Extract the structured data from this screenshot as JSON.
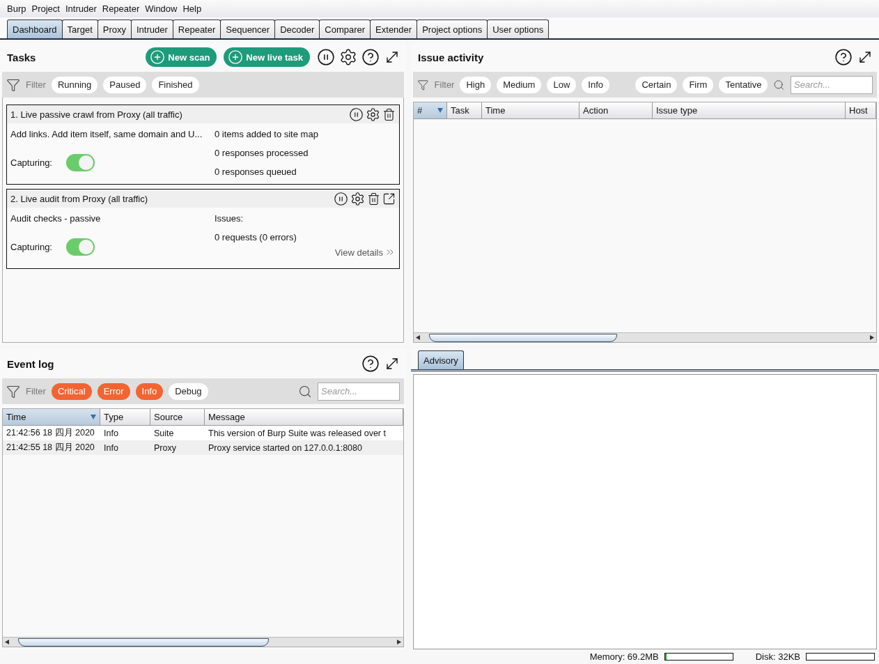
{
  "menu": [
    "Burp",
    "Project",
    "Intruder",
    "Repeater",
    "Window",
    "Help"
  ],
  "tabs": [
    {
      "label": "Dashboard",
      "selected": true
    },
    {
      "label": "Target",
      "selected": false
    },
    {
      "label": "Proxy",
      "selected": false
    },
    {
      "label": "Intruder",
      "selected": false
    },
    {
      "label": "Repeater",
      "selected": false
    },
    {
      "label": "Sequencer",
      "selected": false
    },
    {
      "label": "Decoder",
      "selected": false
    },
    {
      "label": "Comparer",
      "selected": false
    },
    {
      "label": "Extender",
      "selected": false
    },
    {
      "label": "Project options",
      "selected": false
    },
    {
      "label": "User options",
      "selected": false
    }
  ],
  "tasks": {
    "title": "Tasks",
    "buttons": [
      "New scan",
      "New live task"
    ],
    "filter": {
      "label": "Filter",
      "chips": [
        {
          "label": "Running",
          "selected": false
        },
        {
          "label": "Paused",
          "selected": false
        },
        {
          "label": "Finished",
          "selected": false
        }
      ]
    },
    "items": [
      {
        "title": "1. Live passive crawl from Proxy (all traffic)",
        "actions": [
          {
            "kind": "pause"
          },
          {
            "kind": "settings"
          },
          {
            "kind": "delete"
          }
        ],
        "description": "Add links. Add item itself, same domain and U...",
        "capturing_label": "Capturing:",
        "capturing": true,
        "stats": [
          "0 items added to site map",
          "0 responses processed",
          "0 responses queued"
        ]
      },
      {
        "title": "2. Live audit from Proxy (all traffic)",
        "actions": [
          {
            "kind": "pause"
          },
          {
            "kind": "settings"
          },
          {
            "kind": "delete"
          },
          {
            "kind": "open"
          }
        ],
        "description": "Audit checks - passive",
        "capturing_label": "Capturing:",
        "capturing": true,
        "stats": [
          "Issues:",
          "0 requests (0 errors)"
        ],
        "link": "View details"
      }
    ]
  },
  "issue_activity": {
    "title": "Issue activity",
    "filter": {
      "label": "Filter",
      "severity_chips": [
        {
          "label": "High",
          "selected": false
        },
        {
          "label": "Medium",
          "selected": false
        },
        {
          "label": "Low",
          "selected": false
        },
        {
          "label": "Info",
          "selected": false
        }
      ],
      "confidence_chips": [
        {
          "label": "Certain",
          "selected": false
        },
        {
          "label": "Firm",
          "selected": false
        },
        {
          "label": "Tentative",
          "selected": false
        }
      ],
      "search_placeholder": "Search..."
    },
    "columns": [
      {
        "label": "#",
        "sorted": true
      },
      {
        "label": "Task",
        "sorted": false
      },
      {
        "label": "Time",
        "sorted": false
      },
      {
        "label": "Action",
        "sorted": false
      },
      {
        "label": "Issue type",
        "sorted": false
      },
      {
        "label": "Host",
        "sorted": false
      }
    ]
  },
  "event_log": {
    "title": "Event log",
    "filter": {
      "label": "Filter",
      "chips": [
        {
          "label": "Critical",
          "selected": true
        },
        {
          "label": "Error",
          "selected": true
        },
        {
          "label": "Info",
          "selected": true
        },
        {
          "label": "Debug",
          "selected": false
        }
      ],
      "search_placeholder": "Search..."
    },
    "columns": [
      {
        "label": "Time",
        "sorted": true
      },
      {
        "label": "Type",
        "sorted": false
      },
      {
        "label": "Source",
        "sorted": false
      },
      {
        "label": "Message",
        "sorted": false
      }
    ],
    "rows": [
      [
        "21:42:56 18 四月 2020",
        "Info",
        "Suite",
        "This version of Burp Suite was released over t"
      ],
      [
        "21:42:55 18 四月 2020",
        "Info",
        "Proxy",
        "Proxy service started on 127.0.0.1:8080"
      ]
    ]
  },
  "advisory": {
    "tabs": [
      {
        "label": "Advisory",
        "selected": true
      }
    ]
  },
  "status_bar": {
    "memory": {
      "label": "Memory: 69.2MB",
      "level": 0.02
    },
    "disk": {
      "label": "Disk: 32KB"
    }
  }
}
